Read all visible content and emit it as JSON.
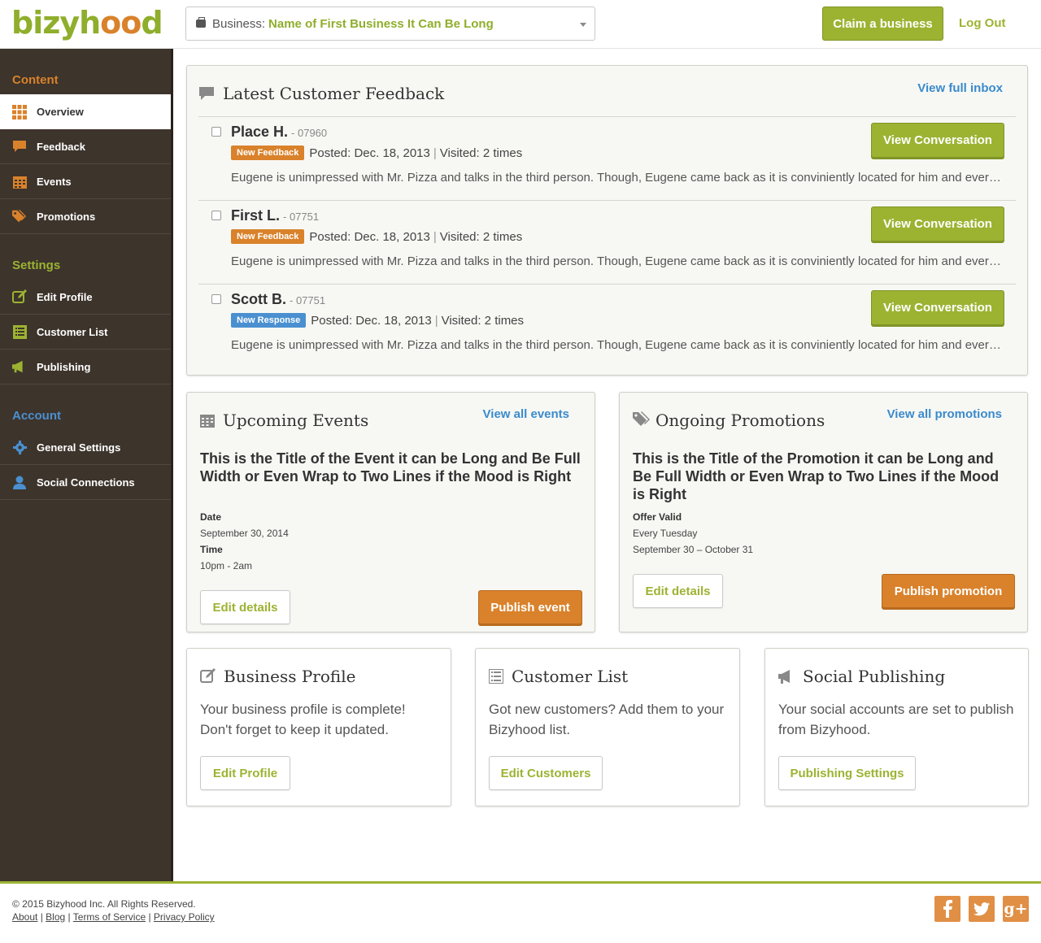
{
  "brand": {
    "logo": "bizyhood",
    "accent_green": "#9cb332",
    "accent_orange": "#d9822b",
    "accent_blue": "#4a90d0",
    "sidebar_bg": "#3d342c"
  },
  "header": {
    "business_prefix": "Business:",
    "business_name": "Name of First Business It Can Be Long",
    "claim_label": "Claim a business",
    "logout_label": "Log Out"
  },
  "sidebar": {
    "content_head": "Content",
    "content_items": [
      {
        "label": "Overview",
        "icon": "grid-icon"
      },
      {
        "label": "Feedback",
        "icon": "comment-icon"
      },
      {
        "label": "Events",
        "icon": "calendar-icon"
      },
      {
        "label": "Promotions",
        "icon": "tags-icon"
      }
    ],
    "settings_head": "Settings",
    "settings_items": [
      {
        "label": "Edit Profile",
        "icon": "edit-icon"
      },
      {
        "label": "Customer List",
        "icon": "list-icon"
      },
      {
        "label": "Publishing",
        "icon": "megaphone-icon"
      }
    ],
    "account_head": "Account",
    "account_items": [
      {
        "label": "General Settings",
        "icon": "gear-icon"
      },
      {
        "label": "Social Connections",
        "icon": "user-icon"
      }
    ]
  },
  "feedback": {
    "title": "Latest Customer Feedback",
    "view_all": "View full inbox",
    "rows": [
      {
        "name": "Place H.",
        "code": "- 07960",
        "badge": "New Feedback",
        "posted": "Posted: Dec. 18, 2013",
        "visited": "Visited: 2 times",
        "snippet": "Eugene is unimpressed with Mr. Pizza and talks in the third person. Though, Eugene came back as it is conviniently located for him and everybody else in the world.",
        "button": "View Conversation"
      },
      {
        "name": "First L.",
        "code": "- 07751",
        "badge": "New Feedback",
        "posted": "Posted: Dec. 18, 2013",
        "visited": "Visited: 2 times",
        "snippet": "Eugene is unimpressed with Mr. Pizza and talks in the third person. Though, Eugene came back as it is conviniently located for him and everybody else in the world.",
        "button": "View Conversation"
      },
      {
        "name": "Scott B.",
        "code": "- 07751",
        "badge": "New Response",
        "posted": "Posted: Dec. 18, 2013",
        "visited": "Visited: 2 times",
        "snippet": "Eugene is unimpressed with Mr. Pizza and talks in the third person. Though, Eugene came back as it is conviniently located for him and everybody else in the world.",
        "button": "View Conversation"
      }
    ]
  },
  "events": {
    "title": "Upcoming Events",
    "view_all": "View all events",
    "event_title": "This is the Title of the Event it can be Long and Be Full Width or Even Wrap to Two Lines if the Mood is Right",
    "date_label": "Date",
    "date_value": "September 30, 2014",
    "time_label": "Time",
    "time_value": "10pm - 2am",
    "edit_label": "Edit details",
    "publish_label": "Publish event"
  },
  "promotions": {
    "title": "Ongoing Promotions",
    "view_all": "View all promotions",
    "promo_title": "This is the Title of the Promotion it can be Long and Be Full Width or Even Wrap to Two Lines if the Mood is Right",
    "offer_label": "Offer Valid",
    "offer_line1": "Every Tuesday",
    "offer_line2": "September 30 – October 31",
    "edit_label": "Edit details",
    "publish_label": "Publish promotion"
  },
  "business_profile": {
    "title": "Business Profile",
    "body": "Your business profile is complete! Don't forget to keep it updated.",
    "button": "Edit Profile"
  },
  "customer_list": {
    "title": "Customer List",
    "body": "Got new customers? Add them to your Bizyhood list.",
    "button": "Edit Customers"
  },
  "social_publishing": {
    "title": "Social Publishing",
    "body": "Your social accounts are set to publish from Bizyhood.",
    "button": "Publishing Settings"
  },
  "footer": {
    "copyright": "© 2015 Bizyhood Inc. All Rights Reserved.",
    "links": [
      "About",
      "Blog",
      "Terms of Service",
      "Privacy Policy"
    ],
    "social": [
      "facebook-icon",
      "twitter-icon",
      "google-plus-icon"
    ]
  }
}
